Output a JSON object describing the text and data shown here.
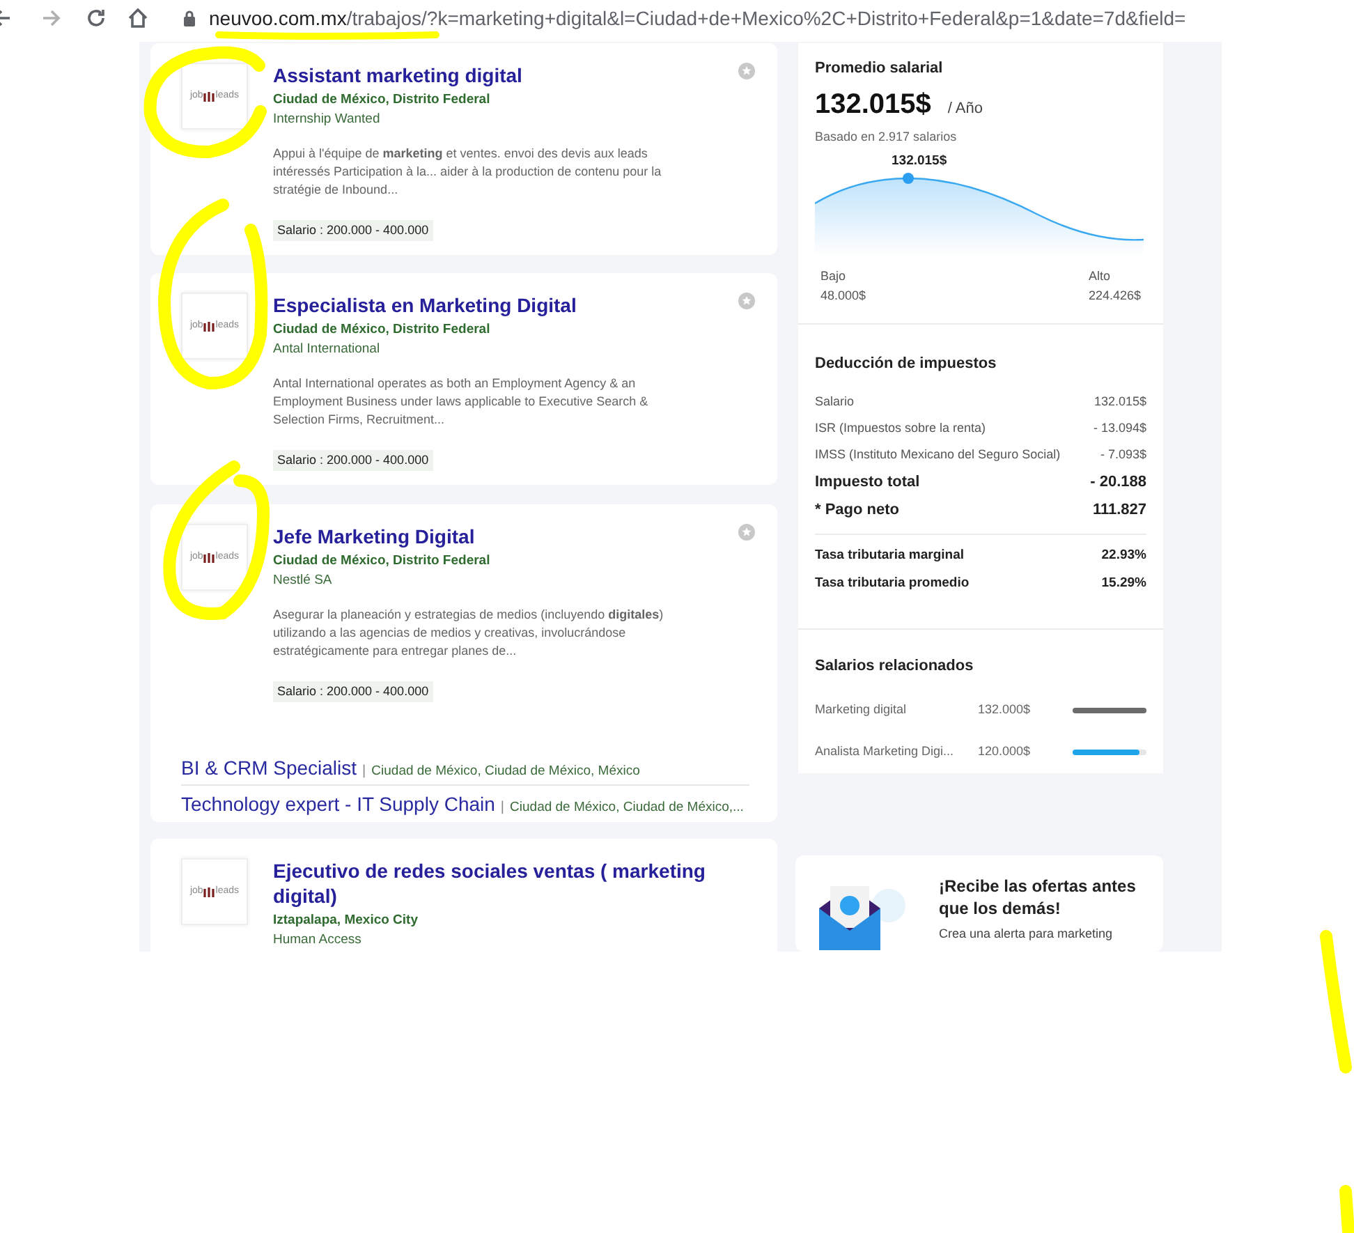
{
  "browser": {
    "url_domain": "neuvoo.com.mx",
    "url_path": "/trabajos/?k=marketing+digital&l=Ciudad+de+Mexico%2C+Distrito+Federal&p=1&date=7d&field="
  },
  "jobs": [
    {
      "logo": [
        "job",
        "leads"
      ],
      "title": "Assistant marketing digital",
      "location": "Ciudad de México, Distrito Federal",
      "company": "Internship Wanted",
      "description": "Appui à l'équipe de **marketing** et ventes. envoi des devis aux leads intéressés Participation à la... aider à la production de contenu pour la stratégie de Inbound...",
      "salary": "Salario : 200.000 - 400.000"
    },
    {
      "logo": [
        "job",
        "leads"
      ],
      "title": "Especialista en Marketing Digital",
      "location": "Ciudad de México, Distrito Federal",
      "company": "Antal International",
      "description": "Antal International operates as both an Employment Agency & an Employment Business under laws applicable to Executive Search & Selection Firms, Recruitment...",
      "salary": "Salario : 200.000 - 400.000"
    },
    {
      "logo": [
        "job",
        "leads"
      ],
      "title": "Jefe Marketing Digital",
      "location": "Ciudad de México, Distrito Federal",
      "company": "Nestlé SA",
      "description": "Asegurar la planeación y estrategias de medios (incluyendo **digitales**) utilizando a las agencias de medios y creativas, involucrándose estratégicamente para entregar planes de...",
      "salary": "Salario : 200.000 - 400.000",
      "related": [
        {
          "title": "BI & CRM Specialist",
          "separator": "|",
          "location": "Ciudad de México, Ciudad de México, México"
        },
        {
          "title": "Technology expert - IT Supply Chain",
          "separator": "|",
          "location": "Ciudad de México, Ciudad de México,..."
        }
      ]
    },
    {
      "logo": [
        "job",
        "leads"
      ],
      "title": "Ejecutivo de redes sociales ventas ( marketing digital)",
      "location": "Iztapalapa, Mexico City",
      "company": "Human Access"
    }
  ],
  "sidebar": {
    "average": {
      "heading": "Promedio salarial",
      "amount": "132.015$",
      "period": "/ Año",
      "basis": "Basado en 2.917 salarios",
      "peak_label": "132.015$",
      "low_label": "Bajo",
      "low_value": "48.000$",
      "high_label": "Alto",
      "high_value": "224.426$"
    },
    "tax": {
      "heading": "Deducción de impuestos",
      "rows": [
        {
          "kind": "item",
          "label": "Salario",
          "value": "132.015$"
        },
        {
          "kind": "item",
          "label": "ISR (Impuestos sobre la renta)",
          "value": "- 13.094$"
        },
        {
          "kind": "item",
          "label": "IMSS (Instituto Mexicano del Seguro Social)",
          "value": "- 7.093$"
        },
        {
          "kind": "total",
          "label": "Impuesto total",
          "value": "- 20.188"
        },
        {
          "kind": "total",
          "label": "* Pago neto",
          "value": "111.827"
        }
      ],
      "rates": [
        {
          "label": "Tasa tributaria marginal",
          "value": "22.93%"
        },
        {
          "label": "Tasa tributaria promedio",
          "value": "15.29%"
        }
      ]
    },
    "related": {
      "heading": "Salarios relacionados",
      "items": [
        {
          "name": "Marketing digital",
          "salary": "132.000$",
          "level": 1.0,
          "color": "#6b6b6b"
        },
        {
          "name": "Analista Marketing Digi...",
          "salary": "120.000$",
          "level": 0.9,
          "color": "#1ea5e8"
        }
      ]
    }
  },
  "alert": {
    "title": "¡Recibe las ofertas antes que los demás!",
    "text": "Crea una alerta para marketing"
  }
}
